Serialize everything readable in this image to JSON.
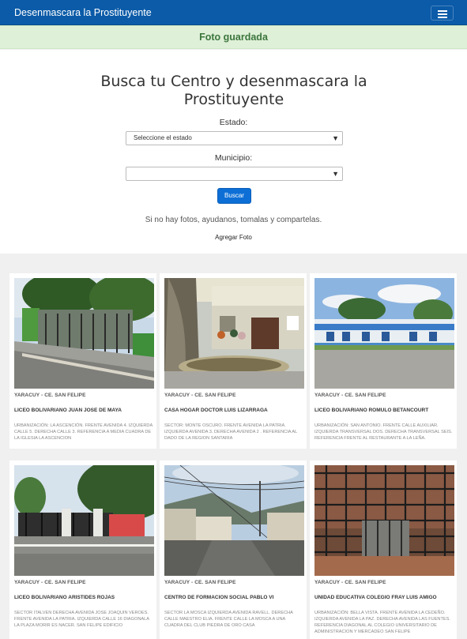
{
  "navbar": {
    "brand": "Desenmascara la Prostituyente"
  },
  "alert": {
    "message": "Foto guardada"
  },
  "search": {
    "title": "Busca tu Centro y desenmascara la Prostituyente",
    "estado_label": "Estado:",
    "estado_value": "Seleccione el estado",
    "municipio_label": "Municipio:",
    "municipio_value": "",
    "button": "Buscar",
    "note": "Si no hay fotos, ayudanos, tomalas y compartelas.",
    "add_link": "Agregar Foto"
  },
  "cards": [
    {
      "state": "YARACUY - CE. SAN FELIPE",
      "name": "LICEO BOLIVARIANO JUAN JOSE DE MAYA",
      "address": "URBANIZACIÓN: LA ASCENCIÓN. FRENTE AVENIDA 4. IZQUIERDA CALLE 5. DERECHA CALLE 3. REFERENCIA A MEDIA CUADRA DE LA IGLESIA LA ASCENCION"
    },
    {
      "state": "YARACUY - CE. SAN FELIPE",
      "name": "CASA HOGAR DOCTOR LUIS LIZARRAGA",
      "address": "SECTOR: MONTE OSCURO. FRENTE AVENIDA LA PATRIA. IZQUIERDA AVENIDA 3. DERECHA AVENIDA 2 . REFERENCIA AL DADO DE LA REGION SANTARIA"
    },
    {
      "state": "YARACUY - CE. SAN FELIPE",
      "name": "LICEO BOLIVARIANO ROMULO BETANCOURT",
      "address": "URBANIZACIÓN: SAN ANTONIO. FRENTE CALLE AUXILIAR. IZQUIERDA TRANSVERSAL DOS. DERECHA TRANSVERSAL SEIS. REFERENCIA FRENTE AL RESTAURANTE A LA LEÑA."
    },
    {
      "state": "YARACUY - CE. SAN FELIPE",
      "name": "LICEO BOLIVARIANO ARISTIDES ROJAS",
      "address": "SECTOR ITALVEN DERECHA AVENIDA JOSE JOAQUIN VEROES. FRENTE AVENIDA LA PATRIA. IZQUIERDA CALLE 16 DIAGONALA LA PLAZA MORIR ES NACER. SAN FELIPE EDIFICIO"
    },
    {
      "state": "YARACUY - CE. SAN FELIPE",
      "name": "CENTRO DE FORMACION SOCIAL PABLO VI",
      "address": "SECTOR LA MOSCA IZQUIERDA AVENIDA RAVELL. DERECHA CALLE MAESTRO ELIA. FRENTE CALLE LA MOSCA A UNA CUADRA DEL CLUB PIEDRA DE ORO CASA"
    },
    {
      "state": "YARACUY - CE. SAN FELIPE",
      "name": "UNIDAD EDUCATIVA COLEGIO FRAY LUIS AMIGO",
      "address": "URBANIZACIÓN: BELLA VISTA. FRENTE AVENIDA LA CEDEÑO. IZQUIERDA AVENIDA LA PAZ. DERECHA AVENIDA LAS FUENTES. REFERENCIA DIAGONAL AL COLEGIO UNIVERSITARIO DE ADMINISTRACION Y MERCADEO SAN FELIPE"
    }
  ]
}
